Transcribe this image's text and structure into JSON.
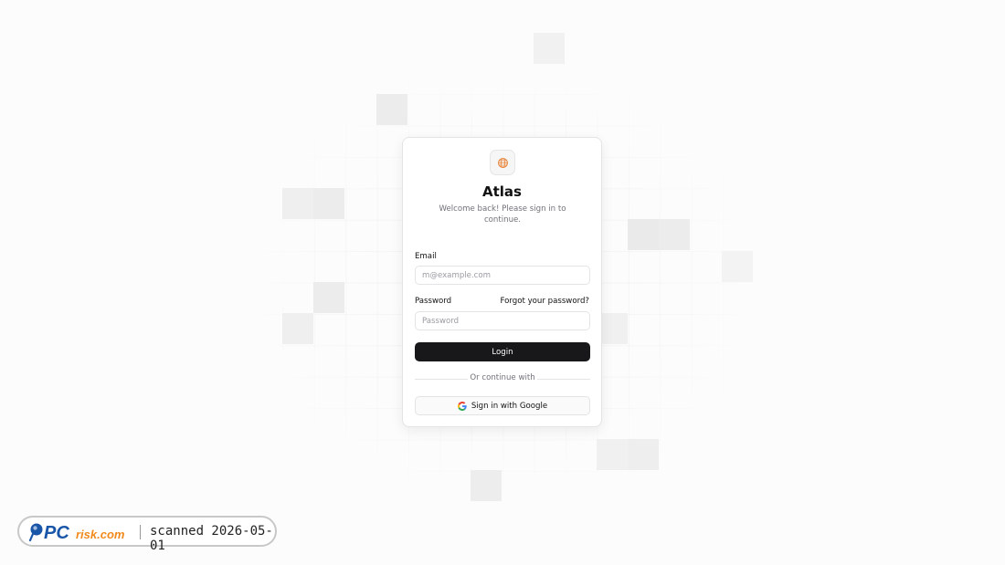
{
  "app": {
    "title": "Atlas",
    "subtitle": "Welcome back! Please sign in to continue."
  },
  "form": {
    "email_label": "Email",
    "email_placeholder": "m@example.com",
    "password_label": "Password",
    "forgot_link": "Forgot your password?",
    "password_placeholder": "Password",
    "login_label": "Login",
    "divider_text": "Or continue with",
    "google_label": "Sign in with Google"
  },
  "watermark": {
    "brand_pc": "PC",
    "brand_risk": "risk.com",
    "scan_text": "scanned 2026-05-01"
  },
  "icons": {
    "logo": "globe-icon",
    "google": "google-icon"
  },
  "colors": {
    "primary_button": "#18181b",
    "logo_accent": "#e8833a",
    "watermark_blue": "#1a56a8",
    "watermark_orange": "#f08a1c"
  }
}
